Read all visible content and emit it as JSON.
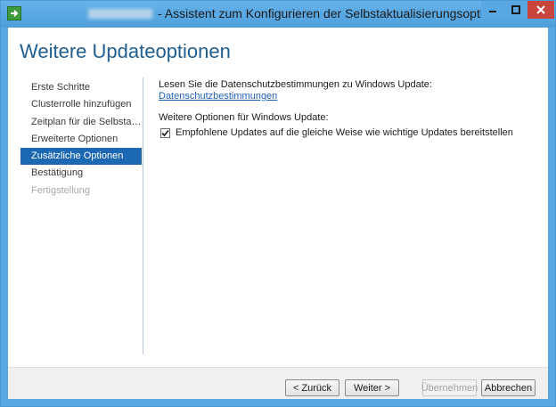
{
  "window": {
    "title": "- Assistent zum Konfigurieren der Selbstaktualisierungsoptionen",
    "min_icon": "minimize-icon",
    "max_icon": "maximize-icon",
    "close_icon": "close-icon"
  },
  "page": {
    "title": "Weitere Updateoptionen"
  },
  "nav": {
    "items": [
      {
        "label": "Erste Schritte",
        "state": "normal"
      },
      {
        "label": "Clusterrolle hinzufügen",
        "state": "normal"
      },
      {
        "label": "Zeitplan für die Selbstakt...",
        "state": "normal"
      },
      {
        "label": "Erweiterte Optionen",
        "state": "normal"
      },
      {
        "label": "Zusätzliche Optionen",
        "state": "selected"
      },
      {
        "label": "Bestätigung",
        "state": "normal"
      },
      {
        "label": "Fertigstellung",
        "state": "disabled"
      }
    ]
  },
  "content": {
    "privacy_label": "Lesen Sie die Datenschutzbestimmungen zu Windows Update:",
    "privacy_link": "Datenschutzbestimmungen",
    "options_label": "Weitere Optionen für Windows Update:",
    "recommended_checkbox": {
      "label": "Empfohlene Updates auf die gleiche Weise wie wichtige Updates bereitstellen",
      "checked": true
    }
  },
  "footer": {
    "back": "< Zurück",
    "next": "Weiter >",
    "apply": "Übernehmen",
    "cancel": "Abbrechen"
  },
  "colors": {
    "title_bar": "#5aa8e3",
    "accent": "#1d68b3",
    "heading": "#1f5e91",
    "link": "#1e63b8",
    "close_button": "#c9443a"
  }
}
